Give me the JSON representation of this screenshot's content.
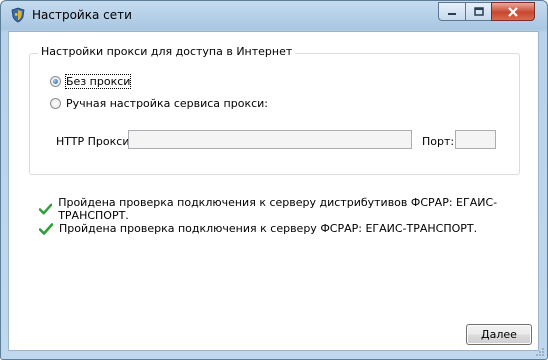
{
  "window": {
    "title": "Настройка сети"
  },
  "proxy_group": {
    "legend": "Настройки прокси для доступа в Интернет",
    "option_no_proxy": {
      "label": "Без прокси",
      "checked": true
    },
    "option_manual": {
      "label": "Ручная настройка сервиса прокси:",
      "checked": false
    },
    "http_label": "HTTP Прокси:",
    "http_value": "",
    "port_label": "Порт:",
    "port_value": ""
  },
  "status_messages": [
    {
      "text": "Пройдена проверка подключения к серверу дистрибутивов ФСРАР: ЕГАИС-ТРАНСПОРТ.",
      "icon": "check-icon"
    },
    {
      "text": "Пройдена проверка подключения к серверу ФСРАР: ЕГАИС-ТРАНСПОРТ.",
      "icon": "check-icon"
    }
  ],
  "buttons": {
    "next_label": "Далее"
  },
  "colors": {
    "check_green": "#2e9e3a",
    "close_red": "#c8472f"
  }
}
